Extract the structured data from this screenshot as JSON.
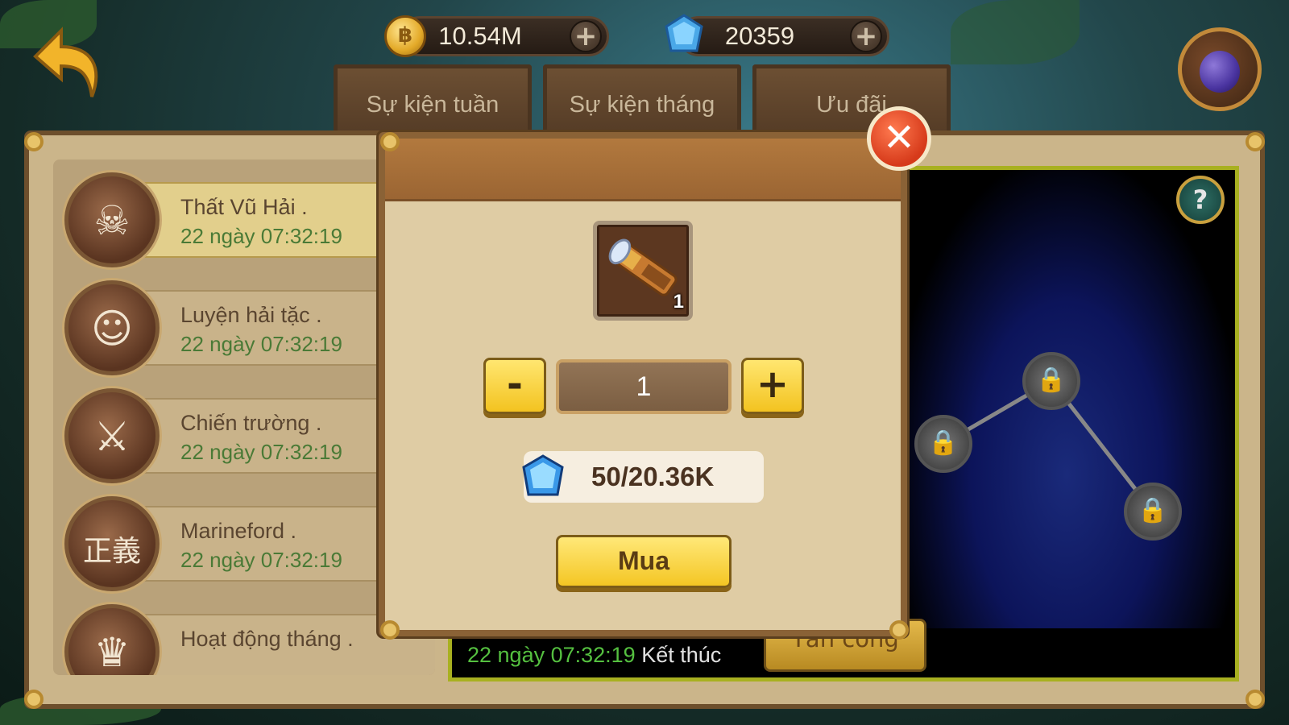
{
  "currencies": {
    "gold": {
      "value": "10.54M",
      "icon": "gold-coin-icon"
    },
    "gems": {
      "value": "20359",
      "icon": "blue-gem-icon"
    }
  },
  "tabs": [
    {
      "label": "Sự kiện tuần"
    },
    {
      "label": "Sự kiện tháng"
    },
    {
      "label": "Ưu đãi"
    }
  ],
  "events": [
    {
      "name": "Thất Vũ Hải .",
      "time": "22 ngày 07:32:19",
      "icon": "skull-emblem-icon",
      "selected": true
    },
    {
      "name": "Luyện hải tặc .",
      "time": "22 ngày 07:32:19",
      "icon": "old-pirate-portrait-icon"
    },
    {
      "name": "Chiến trường .",
      "time": "22 ngày 07:32:19",
      "icon": "crossed-swords-icon"
    },
    {
      "name": "Marineford .",
      "time": "22 ngày 07:32:19",
      "icon": "justice-coat-icon"
    },
    {
      "name": "Hoạt động tháng .",
      "time": "",
      "icon": "purple-crown-icon"
    }
  ],
  "map": {
    "help": "?",
    "end_time": "22 ngày 07:32:19",
    "end_label": "Kết thúc",
    "attack_label": "Tấn công"
  },
  "modal": {
    "item_icon": "spyglass-icon",
    "item_count": "1",
    "minus": "-",
    "plus": "+",
    "quantity": "1",
    "price": "50/20.36K",
    "price_icon": "blue-gem-icon",
    "buy_label": "Mua",
    "close": "✕"
  },
  "colors": {
    "time_green": "#4a7a36",
    "button_yellow": "#f4c624",
    "close_red": "#d63a1a",
    "panel_parchment": "#dfcca4"
  }
}
